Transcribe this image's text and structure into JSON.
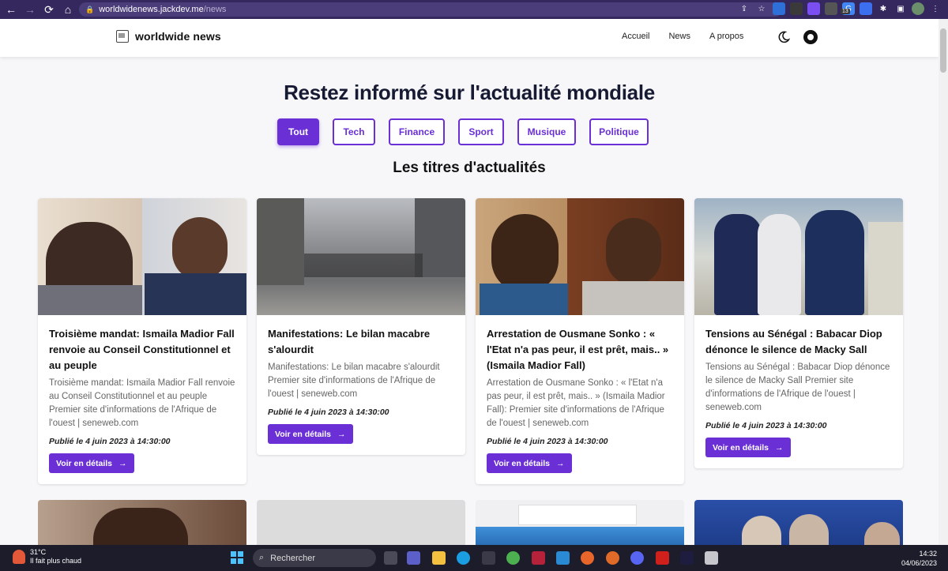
{
  "browser": {
    "url_host": "worldwidenews.jackdev.me",
    "url_path": "/news",
    "badge": "13"
  },
  "header": {
    "logo_text": "worldwide news",
    "nav": [
      "Accueil",
      "News",
      "A propos"
    ]
  },
  "hero": {
    "title": "Restez informé sur l'actualité mondiale",
    "filters": [
      "Tout",
      "Tech",
      "Finance",
      "Sport",
      "Musique",
      "Politique"
    ],
    "active_filter": "Tout",
    "section_title": "Les titres d'actualités"
  },
  "cards": [
    {
      "title": "Troisième mandat: Ismaila Madior Fall renvoie au Conseil Constitutionnel et au peuple",
      "description": "Troisième mandat: Ismaila Madior Fall renvoie au Conseil Constitutionnel et au peuple Premier site d'informations de l'Afrique de l'ouest | seneweb.com",
      "date": "Publié le 4 juin 2023 à 14:30:00",
      "button": "Voir en détails"
    },
    {
      "title": "Manifestations: Le bilan macabre s'alourdit",
      "description": "Manifestations: Le bilan macabre s'alourdit Premier site d'informations de l'Afrique de l'ouest | seneweb.com",
      "date": "Publié le 4 juin 2023 à 14:30:00",
      "button": "Voir en détails"
    },
    {
      "title": "Arrestation de Ousmane Sonko : « l'Etat n'a pas peur, il est prêt, mais.. » (Ismaila Madior Fall)",
      "description": "Arrestation de Ousmane Sonko : « l'Etat n'a pas peur, il est prêt, mais.. » (Ismaila Madior Fall): Premier site d'informations de l'Afrique de l'ouest | seneweb.com",
      "date": "Publié le 4 juin 2023 à 14:30:00",
      "button": "Voir en détails"
    },
    {
      "title": "Tensions au Sénégal : Babacar Diop dénonce le silence de Macky Sall",
      "description": "Tensions au Sénégal : Babacar Diop dénonce le silence de Macky Sall Premier site d'informations de l'Afrique de l'ouest | seneweb.com",
      "date": "Publié le 4 juin 2023 à 14:30:00",
      "button": "Voir en détails"
    }
  ],
  "taskbar": {
    "temperature": "31°C",
    "weather": "Il fait plus chaud",
    "search": "Rechercher",
    "time": "14:32",
    "date": "04/06/2023"
  },
  "colors": {
    "accent": "#6b2fd6",
    "browser_bar": "#35285f"
  }
}
